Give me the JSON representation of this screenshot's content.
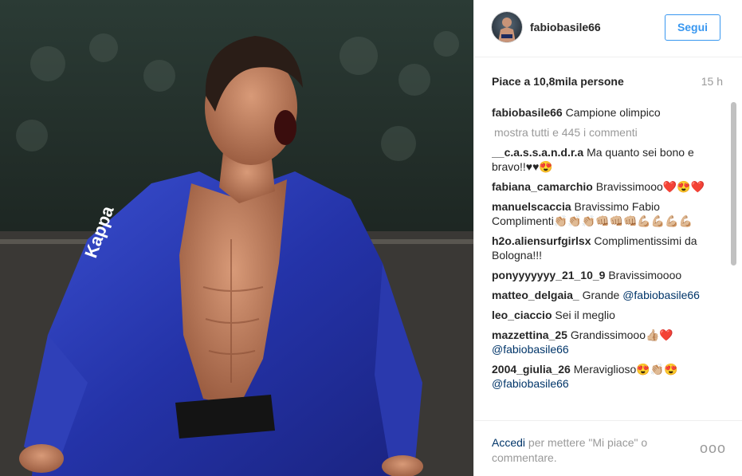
{
  "header": {
    "username": "fabiobasile66",
    "follow_label": "Segui"
  },
  "post": {
    "likes": "Piace a 10,8mila persone",
    "time": "15 h"
  },
  "caption": {
    "user": "fabiobasile66",
    "text": "Campione olimpico"
  },
  "show_all": "mostra tutti e 445 i commenti",
  "comments": [
    {
      "user": "__c.a.s.s.a.n.d.r.a",
      "text": "Ma quanto sei bono e bravo!!♥♥😍",
      "mention": ""
    },
    {
      "user": "fabiana_camarchio",
      "text": "Bravissimooo❤️😍❤️",
      "mention": ""
    },
    {
      "user": "manuelscaccia",
      "text": "Bravissimo Fabio Complimenti👏🏼👏🏼👏🏼👊🏼👊🏼👊🏼💪🏼💪🏼💪🏼💪🏼",
      "mention": ""
    },
    {
      "user": "h2o.aliensurfgirlsx",
      "text": "Complimentissimi da Bologna!!!",
      "mention": ""
    },
    {
      "user": "ponyyyyyyy_21_10_9",
      "text": "Bravissimoooo",
      "mention": ""
    },
    {
      "user": "matteo_delgaia_",
      "text": "Grande ",
      "mention": "@fabiobasile66"
    },
    {
      "user": "leo_ciaccio",
      "text": "Sei il meglio",
      "mention": ""
    },
    {
      "user": "mazzettina_25",
      "text": "Grandissimooo👍🏼❤️",
      "mention": "@fabiobasile66"
    },
    {
      "user": "2004_giulia_26",
      "text": "Meraviglioso😍👏🏼😍",
      "mention": "@fabiobasile66"
    }
  ],
  "footer": {
    "login_link": "Accedi",
    "login_text": " per mettere \"Mi piace\" o commentare.",
    "more_options": "ooo"
  }
}
